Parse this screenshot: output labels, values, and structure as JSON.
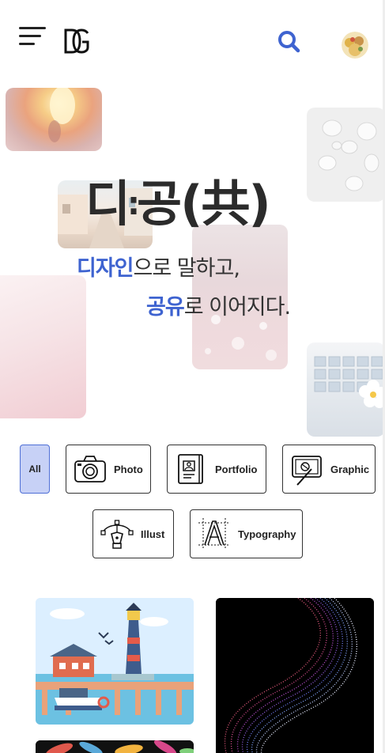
{
  "header": {
    "logo_text": "DG",
    "icons": {
      "menu": "hamburger-menu-icon",
      "search": "search-icon",
      "profile": "avatar"
    },
    "accent_color": "#3e63d0"
  },
  "hero": {
    "title": "디",
    "title_sep": ":",
    "title_rest": "공(共)",
    "line1_accent": "디자인",
    "line1_rest": "으로 말하고,",
    "line2_accent": "공유",
    "line2_rest": "로 이어지다."
  },
  "categories": [
    {
      "label": "All",
      "icon": "",
      "selected": true
    },
    {
      "label": "Photo",
      "icon": "camera-icon",
      "selected": false
    },
    {
      "label": "Portfolio",
      "icon": "portfolio-book-icon",
      "selected": false
    },
    {
      "label": "Graphic",
      "icon": "graphic-tablet-icon",
      "selected": false
    },
    {
      "label": "Illust",
      "icon": "pen-tool-icon",
      "selected": false
    },
    {
      "label": "Typography",
      "icon": "typography-icon",
      "selected": false
    }
  ],
  "colors": {
    "selected_chip_bg": "#c7d1f6",
    "selected_chip_border": "#4f6fd6",
    "text": "#222222"
  }
}
